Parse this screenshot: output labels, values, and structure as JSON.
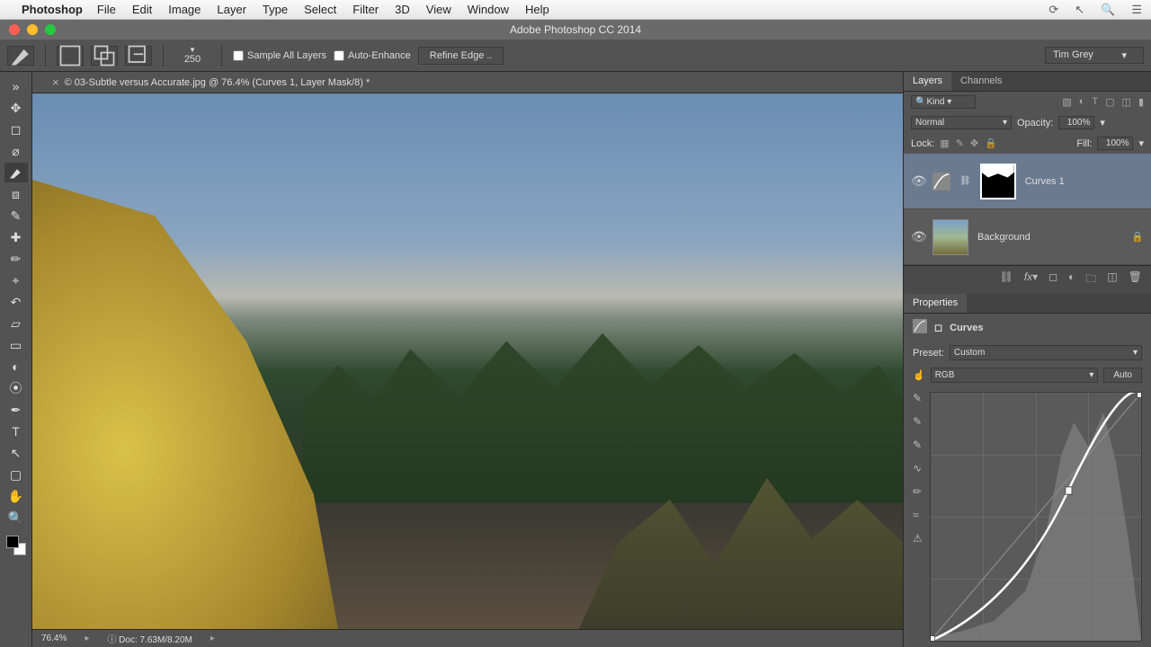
{
  "mac_menu": {
    "app": "Photoshop",
    "items": [
      "File",
      "Edit",
      "Image",
      "Layer",
      "Type",
      "Select",
      "Filter",
      "3D",
      "View",
      "Window",
      "Help"
    ]
  },
  "app_title": "Adobe Photoshop CC 2014",
  "options_bar": {
    "brush_size": "250",
    "sample_all_layers": "Sample All Layers",
    "auto_enhance": "Auto-Enhance",
    "refine_edge": "Refine Edge ..",
    "workspace": "Tim Grey"
  },
  "document": {
    "tab_title": "© 03-Subtle versus Accurate.jpg @ 76.4% (Curves 1, Layer Mask/8) *",
    "zoom": "76.4%",
    "doc_size": "Doc: 7.63M/8.20M"
  },
  "layers_panel": {
    "tabs": [
      "Layers",
      "Channels"
    ],
    "filter_kind": "Kind",
    "blend_mode": "Normal",
    "opacity_label": "Opacity:",
    "opacity_value": "100%",
    "lock_label": "Lock:",
    "fill_label": "Fill:",
    "fill_value": "100%",
    "layers": [
      {
        "name": "Curves 1",
        "type": "adjustment",
        "selected": true
      },
      {
        "name": "Background",
        "type": "image",
        "locked": true
      }
    ]
  },
  "properties_panel": {
    "title": "Properties",
    "adjustment_name": "Curves",
    "preset_label": "Preset:",
    "preset_value": "Custom",
    "channel_value": "RGB",
    "auto_label": "Auto"
  }
}
